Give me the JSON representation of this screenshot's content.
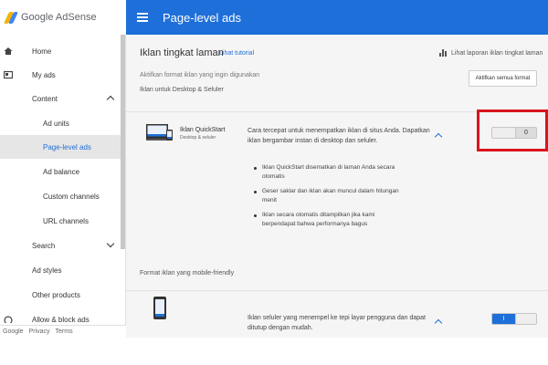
{
  "app": {
    "logo_text": "Google AdSense",
    "page_title": "Page-level ads"
  },
  "sidebar": {
    "items": [
      {
        "label": "Home",
        "icon": "home-icon"
      },
      {
        "label": "My ads",
        "icon": "ads-icon"
      },
      {
        "label": "Content"
      },
      {
        "label": "Ad units"
      },
      {
        "label": "Page-level ads"
      },
      {
        "label": "Ad balance"
      },
      {
        "label": "Custom channels"
      },
      {
        "label": "URL channels"
      },
      {
        "label": "Search"
      },
      {
        "label": "Ad styles"
      },
      {
        "label": "Other products"
      },
      {
        "label": "Allow & block ads"
      }
    ],
    "footer": {
      "google": "Google",
      "privacy": "Privacy",
      "terms": "Terms"
    }
  },
  "main": {
    "heading": "Iklan tingkat laman",
    "tutorial_link": "Lihat tutorial",
    "report_link": "Lihat laporan iklan tingkat laman",
    "description": "Aktifkan format iklan yang ingin digunakan",
    "section_desktop": "Iklan untuk Desktop & Seluler",
    "enable_all_button": "Aktifkan semua format",
    "quickstart": {
      "title": "Iklan QuickStart",
      "subtitle": "Desktop & seluler",
      "description": "Cara tercepat untuk menempatkan iklan di situs Anda. Dapatkan iklan bergambar instan di desktop dan seluler.",
      "toggle_state": "0",
      "bullets": [
        "Iklan QuickStart disematkan di laman Anda secara otomatis",
        "Geser saklar dan iklan akan muncul dalam hitungan menit",
        "Iklan secara otomatis ditampilkan jika kami berpendapat bahwa performanya bagus"
      ]
    },
    "section_mobile": "Format iklan yang mobile-friendly",
    "anchor": {
      "description": "Iklan seluler yang menempel ke tepi layar pengguna dan dapat ditutup dengan mudah.",
      "toggle_state": "I"
    }
  },
  "colors": {
    "accent": "#1e6fd9",
    "highlight": "#d9141c"
  }
}
